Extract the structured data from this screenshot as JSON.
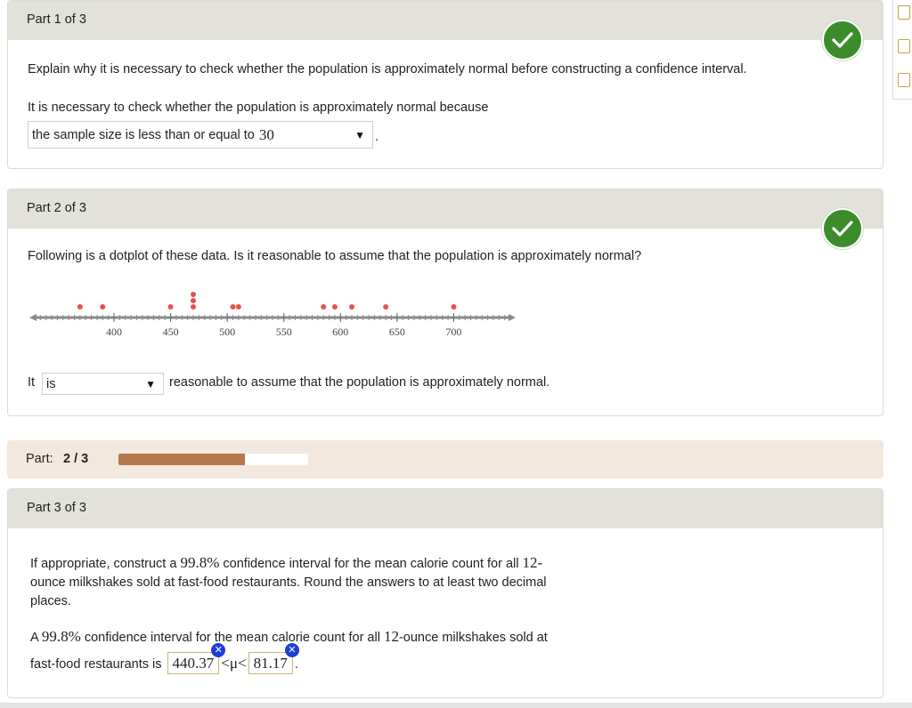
{
  "part1": {
    "header": "Part 1 of 3",
    "question": "Explain why it is necessary to check whether the population is approximately normal before constructing a confidence interval.",
    "prompt": "It is necessary to check whether the population is approximately normal because",
    "dropdown_prefix": "the sample size is less than or equal to",
    "dropdown_number": "30",
    "suffix": "."
  },
  "part2": {
    "header": "Part 2 of 3",
    "question": "Following is a dotplot of these data. Is it reasonable to assume that the population is approximately normal?",
    "answer_prefix": "It",
    "dropdown_value": "is",
    "answer_suffix": "reasonable to assume that the population is approximately normal."
  },
  "progress": {
    "label": "Part:",
    "value": "2 / 3",
    "fraction": 0.6667,
    "fill_color": "#b5784c"
  },
  "part3": {
    "header": "Part 3 of 3",
    "q_line1a": "If appropriate, construct a",
    "q_pct": "99.8%",
    "q_line1b": "confidence interval for the mean calorie count for all",
    "q_num12": "12-",
    "q_line2": "ounce milkshakes sold at fast-food restaurants. Round the answers to at least two decimal",
    "q_line3": "places.",
    "a_line1a": "A",
    "a_pct": "99.8%",
    "a_line1b": "confidence interval for the mean calorie count for all",
    "a_num12": "12",
    "a_line1c": "-ounce milkshakes sold at",
    "a_line2": "fast-food restaurants is",
    "lower": "440.37",
    "ineq": "<μ<",
    "upper": "81.17",
    "end": "."
  },
  "icons": {
    "correct": "checkmark-icon",
    "incorrect": "x-icon",
    "dropdown": "triangle-down-icon"
  },
  "chart_data": {
    "type": "scatter",
    "xlim": [
      330,
      750
    ],
    "ticks": [
      "400",
      "450",
      "500",
      "550",
      "600",
      "650",
      "700"
    ],
    "points": [
      {
        "x": 370,
        "count": 1
      },
      {
        "x": 390,
        "count": 1
      },
      {
        "x": 450,
        "count": 1
      },
      {
        "x": 470,
        "count": 3
      },
      {
        "x": 505,
        "count": 1
      },
      {
        "x": 510,
        "count": 1
      },
      {
        "x": 585,
        "count": 1
      },
      {
        "x": 595,
        "count": 1
      },
      {
        "x": 610,
        "count": 1
      },
      {
        "x": 640,
        "count": 1
      },
      {
        "x": 700,
        "count": 1
      }
    ],
    "dot_color": "#e8524a"
  }
}
